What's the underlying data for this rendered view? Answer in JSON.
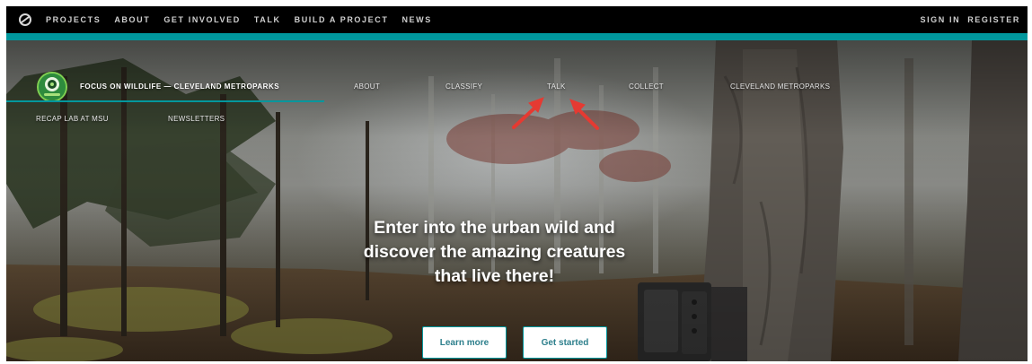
{
  "topbar": {
    "logo_icon": "zooniverse-logo-icon",
    "nav": [
      "PROJECTS",
      "ABOUT",
      "GET INVOLVED",
      "TALK",
      "BUILD A PROJECT",
      "NEWS"
    ],
    "sign_in": "SIGN IN",
    "register": "REGISTER"
  },
  "project": {
    "title": "FOCUS ON WILDLIFE — CLEVELAND METROPARKS",
    "nav": {
      "about": "ABOUT",
      "classify": "CLASSIFY",
      "talk": "TALK",
      "collect": "COLLECT",
      "metroparks": "CLEVELAND METROPARKS",
      "recap": "RECAP LAB AT MSU",
      "newsletters": "NEWSLETTERS"
    }
  },
  "hero": {
    "headline_lines": [
      "Enter into the urban wild and",
      "discover the amazing creatures",
      "that live there!"
    ],
    "learn_more": "Learn more",
    "get_started": "Get started"
  },
  "colors": {
    "teal": "#00979d",
    "topbar": "#000000",
    "annotation_arrow": "#e53a32"
  }
}
